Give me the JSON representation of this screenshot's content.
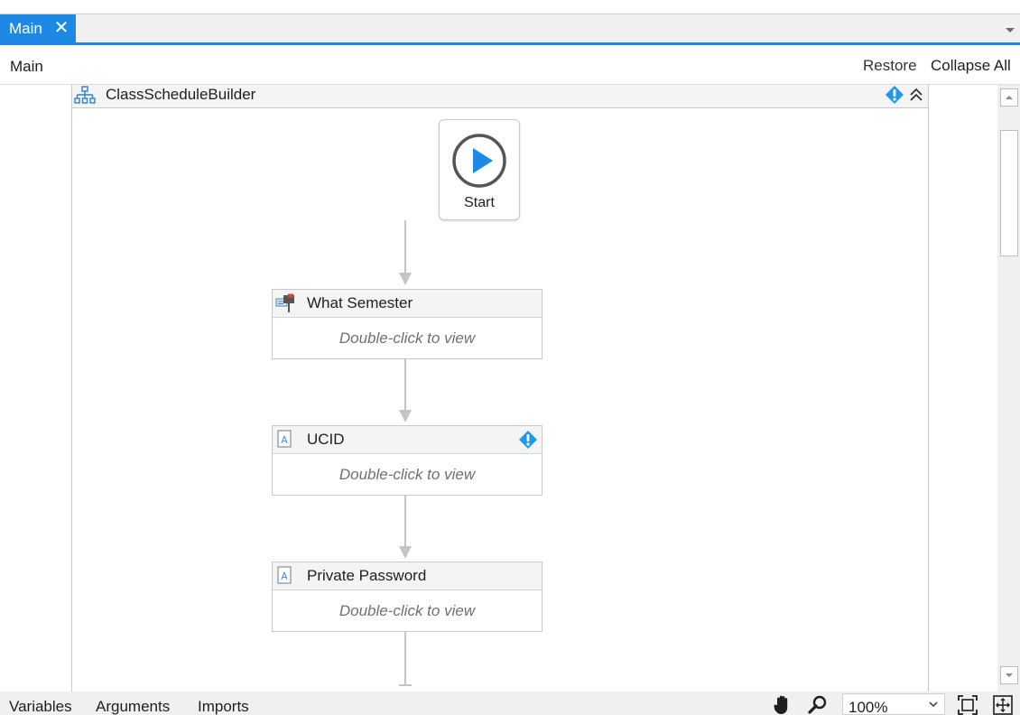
{
  "tab": {
    "label": "Main",
    "close_glyph": "✕"
  },
  "breadcrumb": {
    "label": "Main"
  },
  "toolbar": {
    "restore_label": "Restore",
    "collapse_all_label": "Collapse All"
  },
  "sequence": {
    "title": "ClassScheduleBuilder",
    "icon": "flowchart-icon",
    "has_warning": true
  },
  "start_node": {
    "label": "Start",
    "icon": "play-icon"
  },
  "activities": [
    {
      "title": "What Semester",
      "body": "Double-click to view",
      "icon": "message-box-icon",
      "has_warning": false
    },
    {
      "title": "UCID",
      "body": "Double-click to view",
      "icon": "input-dialog-icon",
      "has_warning": true
    },
    {
      "title": "Private Password",
      "body": "Double-click to view",
      "icon": "input-dialog-icon",
      "has_warning": false
    }
  ],
  "bottom_tabs": {
    "variables": "Variables",
    "arguments": "Arguments",
    "imports": "Imports"
  },
  "zoom": {
    "value": "100%"
  },
  "colors": {
    "accent": "#1e88e5",
    "warning": "#1e9be6",
    "connector": "#c4c4c4"
  }
}
